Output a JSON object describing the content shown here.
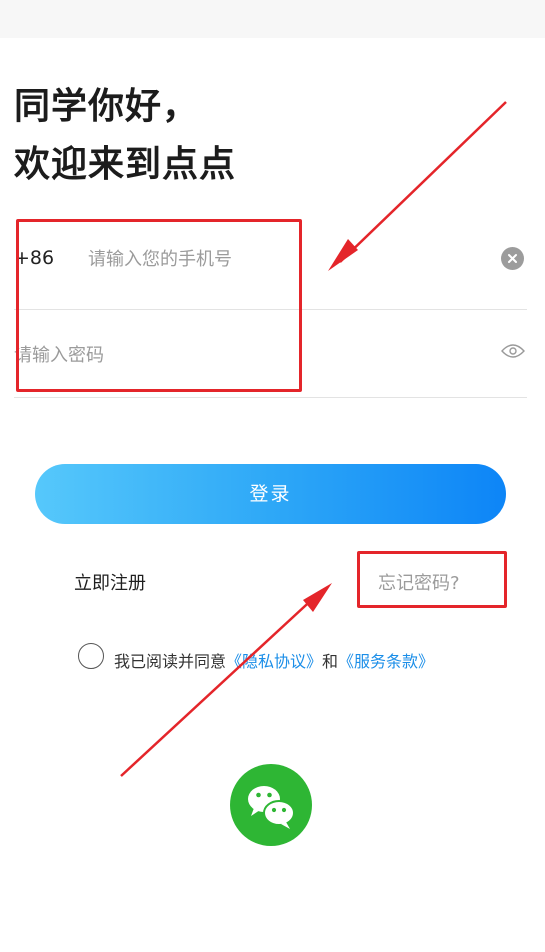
{
  "greeting": {
    "line1": "同学你好，",
    "line2": "欢迎来到点点"
  },
  "phone": {
    "country_code": "+86",
    "placeholder": "请输入您的手机号",
    "value": "",
    "clear_icon": "clear-circle-icon"
  },
  "password": {
    "placeholder": "请输入密码",
    "value": "",
    "toggle_icon": "eye-icon"
  },
  "login_button": {
    "label": "登录"
  },
  "register_link": {
    "label": "立即注册"
  },
  "forgot_link": {
    "label": "忘记密码?"
  },
  "agreement": {
    "prefix": "我已阅读并同意",
    "privacy": "《隐私协议》",
    "connector": "和",
    "terms": "《服务条款》",
    "checked": false
  },
  "wechat_login": {
    "icon": "wechat-icon"
  },
  "colors": {
    "accent_start": "#56c8fb",
    "accent_end": "#0d85f7",
    "link": "#1b8ee8",
    "annotation": "#e4252a",
    "wechat": "#2eb634"
  }
}
